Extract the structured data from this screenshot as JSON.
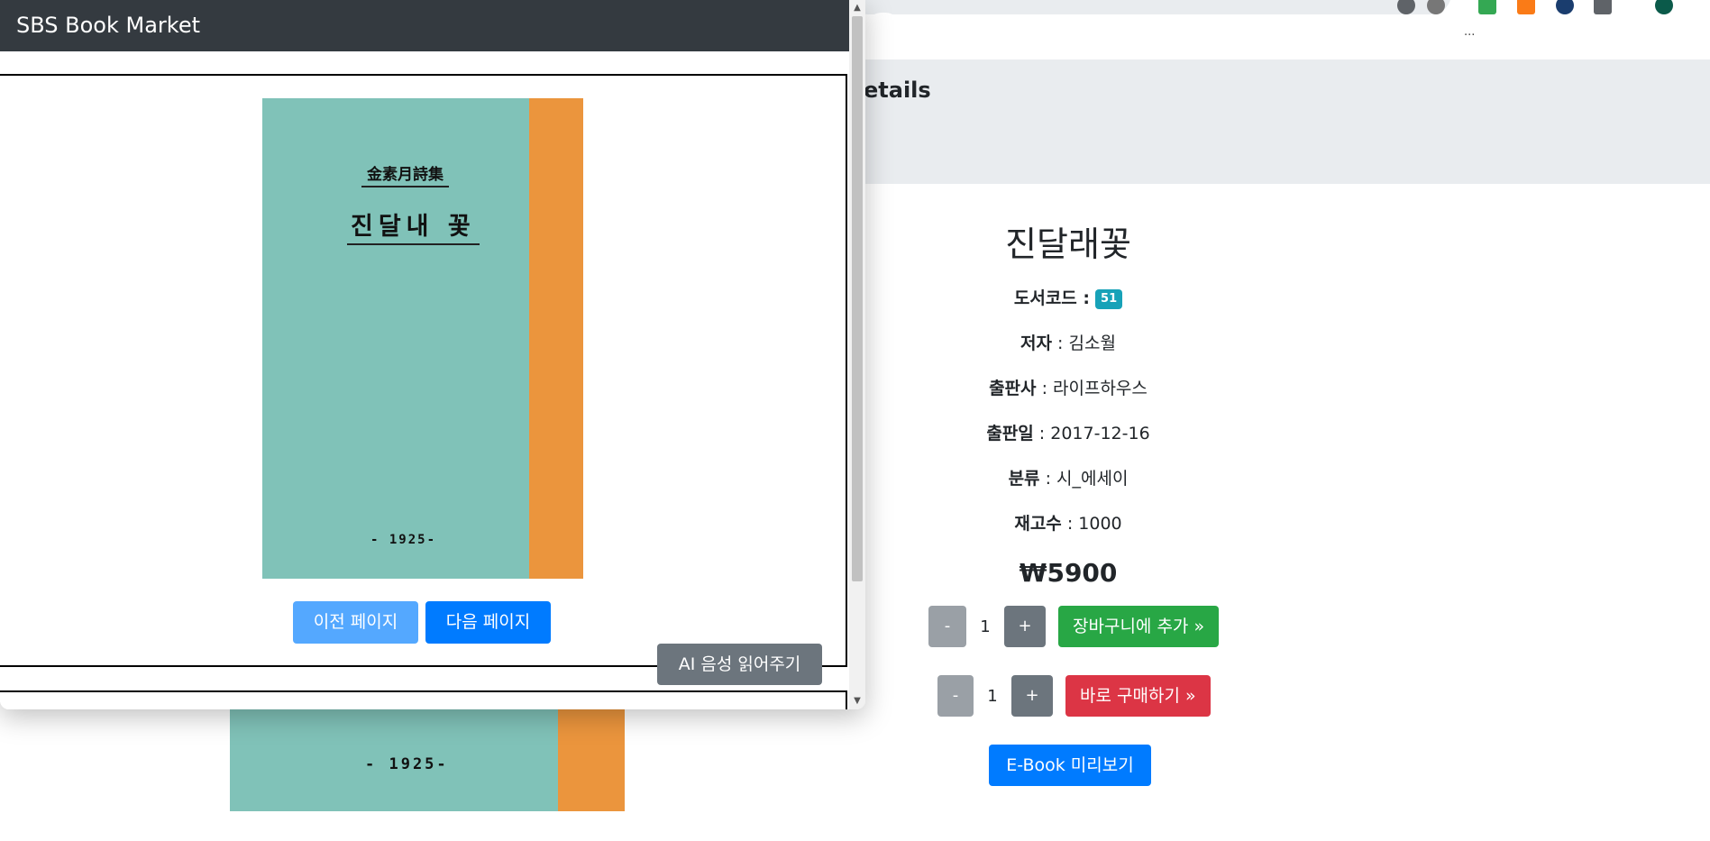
{
  "popup": {
    "title": "SBS Book Market",
    "cover": {
      "series": "金素月詩集",
      "title": "진달내 꽃",
      "year": "- 1925-"
    },
    "prev_label": "이전 페이지",
    "next_label": "다음 페이지",
    "ai_label": "AI 음성 읽어주기"
  },
  "page": {
    "jumbotron_title": "etails",
    "bookmarks_more": "...",
    "book": {
      "title": "진달래꽃",
      "code_label": "도서코드 :",
      "code": "51",
      "author_label": "저자",
      "author": " : 김소월",
      "publisher_label": "출판사",
      "publisher": " : 라이프하우스",
      "date_label": "출판일",
      "date": " : 2017-12-16",
      "category_label": "분류",
      "category": " : 시_에세이",
      "stock_label": "재고수",
      "stock": " : 1000",
      "price": "₩5900"
    },
    "cart": {
      "minus": "-",
      "qty": "1",
      "plus": "+",
      "button": "장바구니에 추가 »"
    },
    "buy": {
      "minus": "-",
      "qty": "1",
      "plus": "+",
      "button": "바로 구매하기 »"
    },
    "ebook_label": "E-Book 미리보기",
    "bg_cover_year": "- 1925-"
  },
  "colors": {
    "header": "#343a40",
    "primary": "#007bff",
    "success": "#28a745",
    "danger": "#dc3545",
    "secondary": "#6c757d",
    "badge": "#17a2b8",
    "cover_teal": "#80c2b8",
    "cover_spine": "#eb953d"
  }
}
